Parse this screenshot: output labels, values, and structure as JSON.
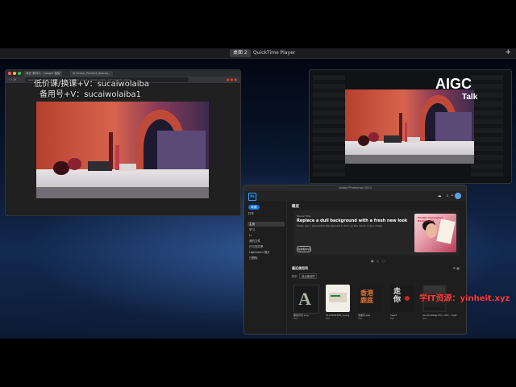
{
  "mission_control": {
    "tabs": [
      "桌面 2",
      "QuickTime Player"
    ],
    "add_symbol": "+"
  },
  "browser": {
    "tabs": [
      "海艺 素材AI - Google 搜索",
      "AI Scene_Product_beauty..."
    ],
    "url": "seaart.ai/create/image?id=product_beauty_scene_orange_purple_arch_lipstick_apple",
    "watermark_line1": "低价课/换课+V：sucaiwolaiba",
    "watermark_line2": "备用号+V：sucaiwolaiba1"
  },
  "logo_overlay": {
    "title": "AIGC",
    "subtitle": "Talk"
  },
  "photoshop": {
    "title": "Adobe Photoshop 2024",
    "logo": "Ps",
    "sidebar": {
      "new_button": "新建",
      "open_button": "打开",
      "items": [
        "主页",
        "学习",
        "Lr",
        "我的文件",
        "已与您共享",
        "Lightroom 照片",
        "已删除"
      ]
    },
    "main": {
      "heading": "概览",
      "banner": {
        "small": "Neural filter",
        "title": "Replace a dull background with a fresh new look",
        "desc": "Easily use a Generative Background to turn up the colors in any image.",
        "button": "在新框中试",
        "image_text": "Firefly: Generative Background"
      },
      "recent_heading": "最近使用项",
      "filter_label": "排序",
      "filter_value": "最近使用项",
      "files": [
        {
          "name": "黑色背景.png",
          "sub": "PNG"
        },
        {
          "name": "0123456789_0.png",
          "sub": "PNG"
        },
        {
          "name": "毛笔字.psd",
          "sub": "PSD"
        },
        {
          "name": "heart",
          "sub": "PSD"
        },
        {
          "name": "Ae-Ch-Sleep-Hm...Pdc...mp4",
          "sub": "MP4"
        }
      ]
    }
  },
  "red_watermark": "学IT资源：yinheit.xyz",
  "colors": {
    "ps_blue": "#31a8ff",
    "accent_blue": "#1473e6",
    "watermark_red": "#ff3b3b"
  }
}
